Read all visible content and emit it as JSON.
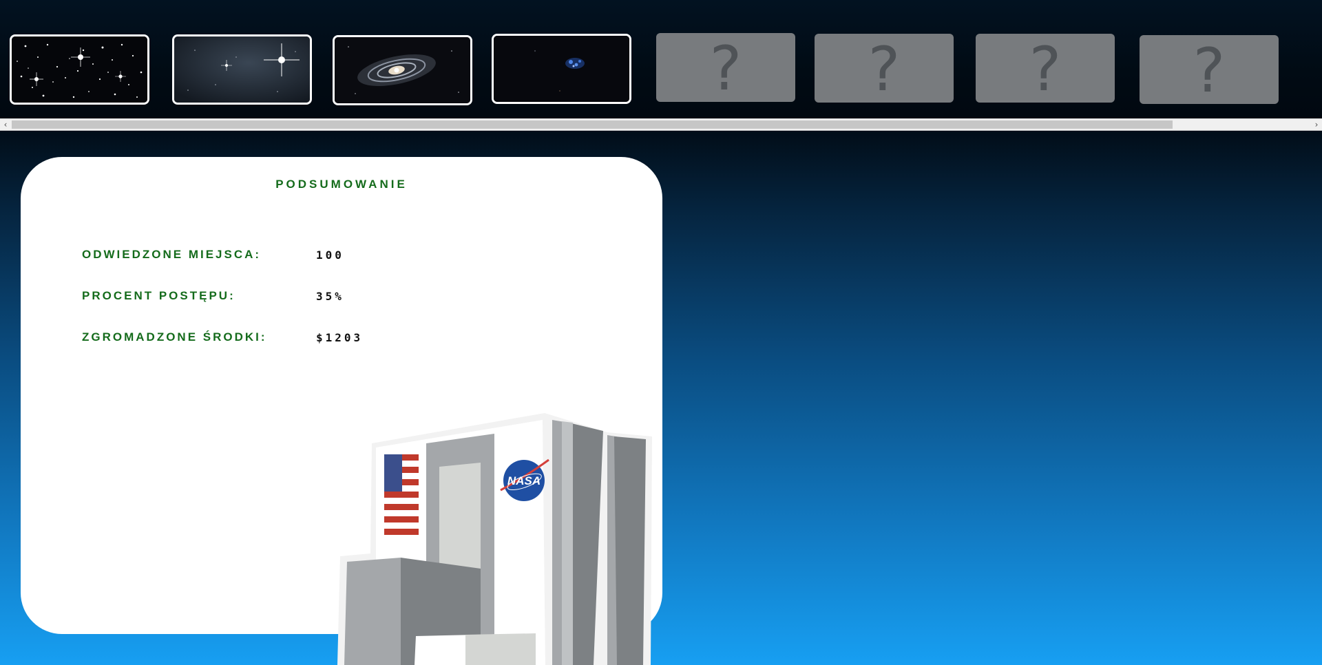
{
  "thumbnails": [
    {
      "name": "star-cluster",
      "locked": false
    },
    {
      "name": "bright-star",
      "locked": false
    },
    {
      "name": "spiral-galaxy",
      "locked": false
    },
    {
      "name": "dwarf-galaxy",
      "locked": false
    },
    {
      "name": "locked-5",
      "locked": true,
      "symbol": "?"
    },
    {
      "name": "locked-6",
      "locked": true,
      "symbol": "?"
    },
    {
      "name": "locked-7",
      "locked": true,
      "symbol": "?"
    },
    {
      "name": "locked-8",
      "locked": true,
      "symbol": "?"
    }
  ],
  "scrollbar": {
    "left_arrow": "‹",
    "right_arrow": "›"
  },
  "summary": {
    "title": "PODSUMOWANIE",
    "stats": [
      {
        "label": "ODWIEDZONE MIEJSCA:",
        "value": "100"
      },
      {
        "label": "PROCENT POSTĘPU:",
        "value": "35%"
      },
      {
        "label": "ZGROMADZONE ŚRODKI:",
        "value": "$1203"
      }
    ]
  },
  "building": {
    "logo_text": "NASA"
  },
  "colors": {
    "label_green": "#146b1b",
    "panel_bg": "#ffffff",
    "locked_tile": "#787b7e",
    "bg_top": "#010d18",
    "bg_bottom": "#179ff2"
  }
}
